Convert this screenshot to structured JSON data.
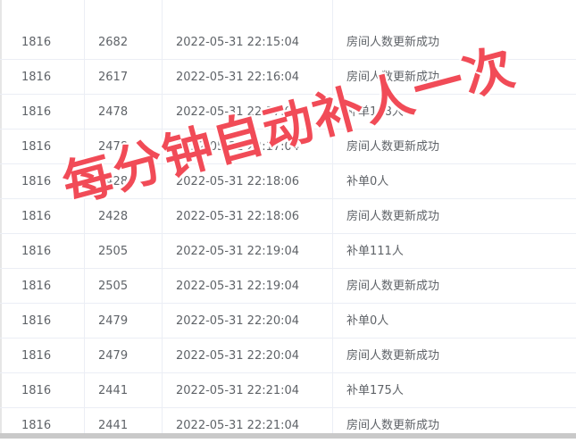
{
  "rows": [
    {
      "a": "1816",
      "b": "2682",
      "time": "2022-05-31 22:15:04",
      "msg": "房间人数更新成功"
    },
    {
      "a": "1816",
      "b": "2617",
      "time": "2022-05-31 22:16:04",
      "msg": "房间人数更新成功"
    },
    {
      "a": "1816",
      "b": "2478",
      "time": "2022-05-31 22:17:04",
      "msg": "补单138人"
    },
    {
      "a": "1816",
      "b": "2478",
      "time": "2022-05-31 22:17:04",
      "msg": "房间人数更新成功"
    },
    {
      "a": "1816",
      "b": "2428",
      "time": "2022-05-31 22:18:06",
      "msg": "补单0人"
    },
    {
      "a": "1816",
      "b": "2428",
      "time": "2022-05-31 22:18:06",
      "msg": "房间人数更新成功"
    },
    {
      "a": "1816",
      "b": "2505",
      "time": "2022-05-31 22:19:04",
      "msg": "补单111人"
    },
    {
      "a": "1816",
      "b": "2505",
      "time": "2022-05-31 22:19:04",
      "msg": "房间人数更新成功"
    },
    {
      "a": "1816",
      "b": "2479",
      "time": "2022-05-31 22:20:04",
      "msg": "补单0人"
    },
    {
      "a": "1816",
      "b": "2479",
      "time": "2022-05-31 22:20:04",
      "msg": "房间人数更新成功"
    },
    {
      "a": "1816",
      "b": "2441",
      "time": "2022-05-31 22:21:04",
      "msg": "补单175人"
    },
    {
      "a": "1816",
      "b": "2441",
      "time": "2022-05-31 22:21:04",
      "msg": "房间人数更新成功"
    }
  ],
  "overlay_text": "每分钟自动补人一次",
  "colors": {
    "text": "#5f6368",
    "grid": "#ebeef5",
    "overlay": "#f14b57"
  }
}
